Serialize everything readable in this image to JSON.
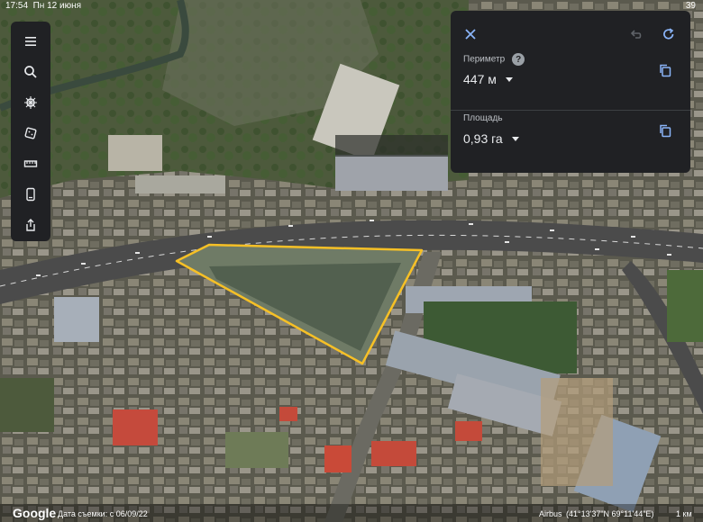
{
  "status": {
    "time": "17:54",
    "date": "Пн 12 июня",
    "battery": "39"
  },
  "toolbar": {
    "items": [
      {
        "name": "menu-icon"
      },
      {
        "name": "search-icon"
      },
      {
        "name": "voyager-icon"
      },
      {
        "name": "feeling-lucky-icon"
      },
      {
        "name": "measure-icon"
      },
      {
        "name": "projects-icon"
      },
      {
        "name": "share-icon"
      }
    ]
  },
  "measure_panel": {
    "perimeter_label": "Периметр",
    "perimeter_value": "447 м",
    "area_label": "Площадь",
    "area_value": "0,93 га",
    "accent_color": "#8ab4f8"
  },
  "bottom_bar": {
    "logo": "Google",
    "imagery_date": "Дата съемки: с 06/09/22",
    "provider": "Airbus",
    "coordinates": "(41°13'37\"N 69°11'44\"E)",
    "scale": "1 км"
  }
}
